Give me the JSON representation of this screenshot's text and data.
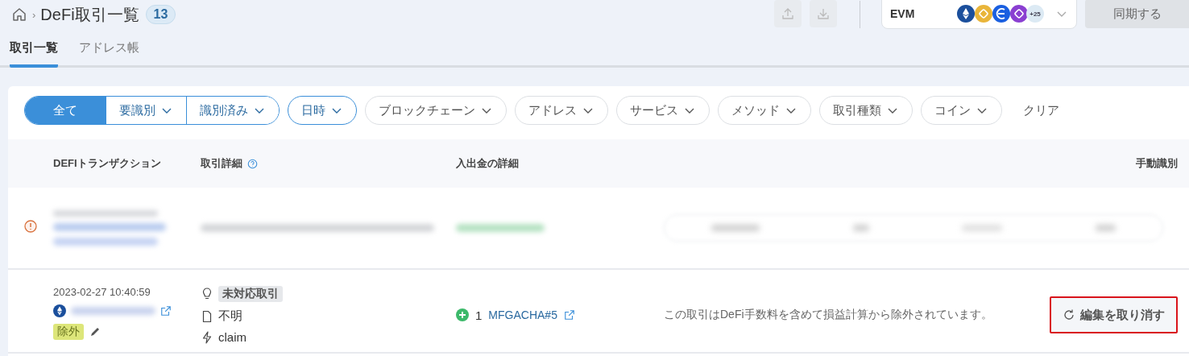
{
  "header": {
    "title": "DeFi取引一覧",
    "count": "13",
    "separator": "›"
  },
  "chain_selector": {
    "label": "EVM",
    "more": "+25"
  },
  "sync_button": {
    "label": "同期する",
    "disabled": true
  },
  "tabs": [
    {
      "label": "取引一覧",
      "selected": true
    },
    {
      "label": "アドレス帳",
      "selected": false
    }
  ],
  "filters": {
    "segments": [
      {
        "label": "全て",
        "selected": true,
        "dropdown": false
      },
      {
        "label": "要識別",
        "selected": false,
        "dropdown": true
      },
      {
        "label": "識別済み",
        "selected": false,
        "dropdown": true
      }
    ],
    "chips": [
      {
        "label": "日時",
        "active": true
      },
      {
        "label": "ブロックチェーン",
        "active": false
      },
      {
        "label": "アドレス",
        "active": false
      },
      {
        "label": "サービス",
        "active": false
      },
      {
        "label": "メソッド",
        "active": false
      },
      {
        "label": "取引種類",
        "active": false
      },
      {
        "label": "コイン",
        "active": false
      }
    ],
    "clear": "クリア"
  },
  "table": {
    "columns": [
      {
        "label": "DEFIトランザクション"
      },
      {
        "label": "取引詳細",
        "help": true
      },
      {
        "label": "入出金の詳細"
      },
      {
        "label": "手動識別"
      }
    ],
    "rows": [
      {
        "kind": "blurred",
        "warning": true
      },
      {
        "kind": "transaction",
        "date": "2023-02-27 10:40:59",
        "status_tag": "除外",
        "detail_tag": "未対応取引",
        "contract": "不明",
        "method": "claim",
        "flow_amount": "1",
        "flow_token": "MFGACHA#5",
        "note": "この取引はDeFi手数料を含めて損益計算から除外されています。",
        "action": "編集を取り消す",
        "highlighted": true
      }
    ]
  }
}
